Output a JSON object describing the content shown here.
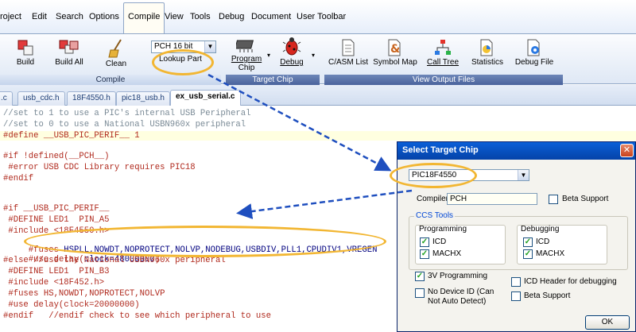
{
  "menu": {
    "items": [
      "roject",
      "Edit",
      "Search",
      "Options",
      "Compile",
      "View",
      "Tools",
      "Debug",
      "Document",
      "User Toolbar"
    ],
    "active": "Compile"
  },
  "ribbon": {
    "compile_group": {
      "label": "Compile",
      "build": "Build",
      "build_all": "Build All",
      "clean": "Clean",
      "compiler_select": "PCH 16 bit",
      "lookup_part": "Lookup Part"
    },
    "target_group": {
      "label": "Target Chip",
      "program_chip_1": "Program",
      "program_chip_2": "Chip",
      "debug": "Debug"
    },
    "output_group": {
      "label": "View Output Files",
      "casm": "C/ASM List",
      "symbol_map": "Symbol Map",
      "call_tree": "Call Tree",
      "statistics": "Statistics",
      "debug_file": "Debug File"
    }
  },
  "tabs": [
    {
      "label": ".c",
      "active": false
    },
    {
      "label": "usb_cdc.h",
      "active": false
    },
    {
      "label": "18F4550.h",
      "active": false
    },
    {
      "label": "pic18_usb.h",
      "active": false
    },
    {
      "label": "ex_usb_serial.c",
      "active": true
    }
  ],
  "code": {
    "l1": "//set to 1 to use a PIC's internal USB Peripheral",
    "l2": "//set to 0 to use a National USBN960x peripheral",
    "l3": "#define __USB_PIC_PERIF__ 1",
    "l4": "#if !defined(__PCH__)",
    "l5": " #error USB CDC Library requires PIC18",
    "l6": "#endif",
    "l7": "#if __USB_PIC_PERIF__",
    "l8": " #DEFINE LED1  PIN_A5",
    "l9": " #include <18F4550.h>",
    "l10a": " #fuses ",
    "l10b": "HSPLL,NOWDT,NOPROTECT,NOLVP,NODEBUG,USBDIV,PLL1,CPUDIV1,VREGEN",
    "l11a": " #use delay(",
    "l11b": "clock=48000000",
    "l11c": ")",
    "l12": "#else //use the National USBN960x peripheral",
    "l13": " #DEFINE LED1  PIN_B3",
    "l14": " #include <18F452.h>",
    "l15": " #fuses HS,NOWDT,NOPROTECT,NOLVP",
    "l16": " #use delay(clock=20000000)",
    "l17": "#endif   //endif check to see which peripheral to use"
  },
  "dialog": {
    "title": "Select Target Chip",
    "chip_value": "PIC18F4550",
    "compiler_label": "Compiler",
    "compiler_value": "PCH",
    "beta_support": "Beta Support",
    "ccs_tools": "CCS Tools",
    "programming": "Programming",
    "debugging": "Debugging",
    "icd": "ICD",
    "machx": "MACHX",
    "v3_programming": "3V Programming",
    "no_device_id_1": "No Device ID (Can",
    "no_device_id_2": "Not Auto Detect)",
    "icd_header": "ICD Header for debugging",
    "beta_support_2": "Beta Support",
    "ok": "OK"
  },
  "colors": {
    "annotation": "#f2b632",
    "arrow": "#1f4fbf"
  }
}
